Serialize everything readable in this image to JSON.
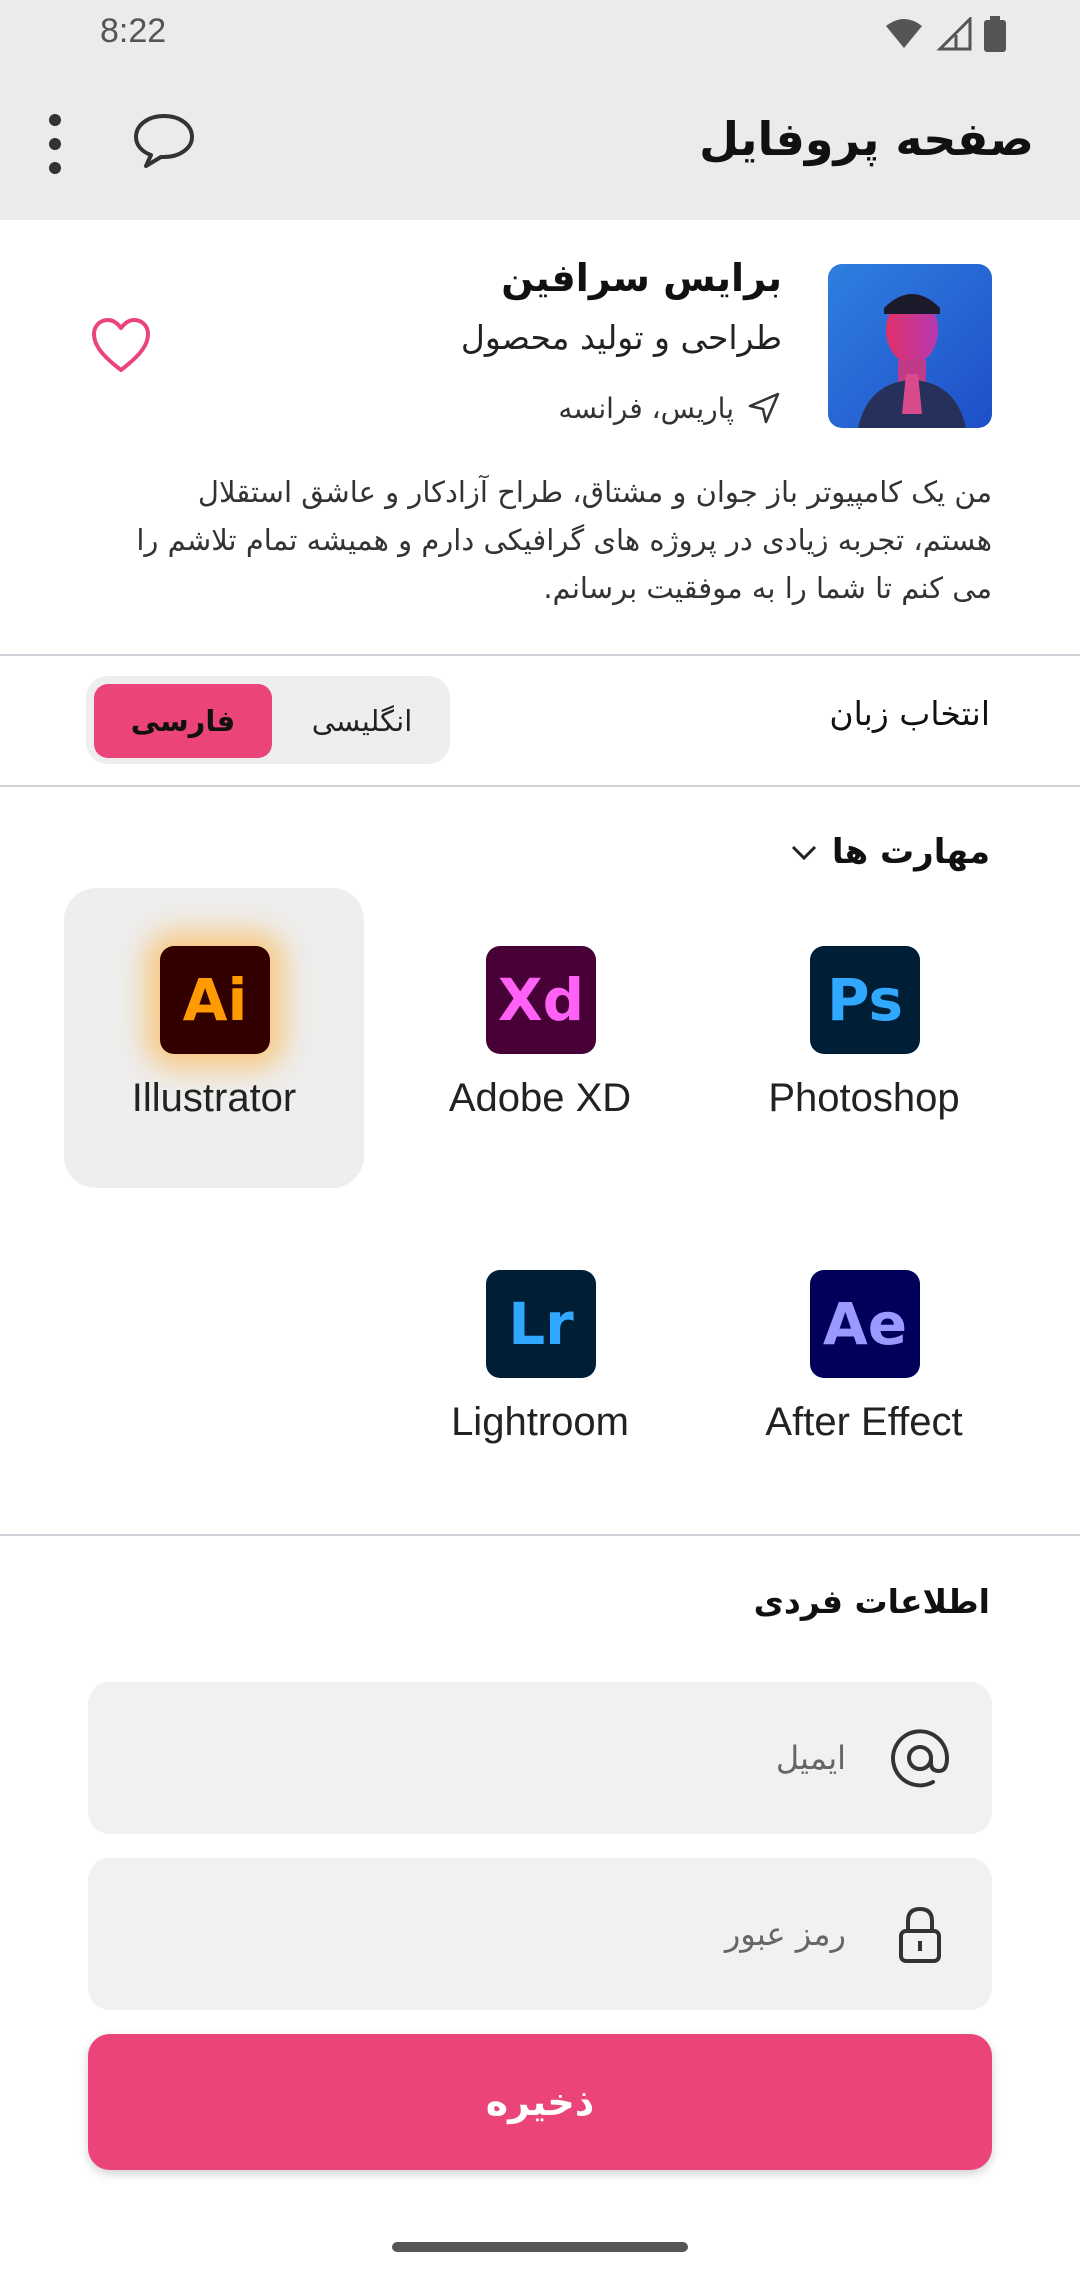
{
  "status_bar": {
    "time": "8:22",
    "icons": [
      "wifi-icon",
      "signal-icon",
      "battery-icon"
    ]
  },
  "app_bar": {
    "title": "صفحه پروفایل",
    "icons": [
      "chat-icon",
      "more-vert-icon"
    ]
  },
  "profile": {
    "name": "برایس سرافین",
    "role": "طراحی و تولید محصول",
    "location": "پاریس، فرانسه",
    "bio": "من یک کامپیوتر باز جوان و مشتاق، طراح آزادکار و عاشق استقلال هستم، تجربه زیادی در پروژه های گرافیکی دارم و همیشه تمام تلاشم را می کنم تا شما را به موفقیت برسانم."
  },
  "language": {
    "label": "انتخاب زبان",
    "options": [
      "فارسی",
      "انگلیسی"
    ],
    "selected": "فارسی"
  },
  "skills": {
    "title": "مهارت ها",
    "items": [
      {
        "label": "Photoshop",
        "abbr": "Ps",
        "bg": "#001e36",
        "fg": "#31a8ff",
        "selected": false
      },
      {
        "label": "Adobe XD",
        "abbr": "Xd",
        "bg": "#470137",
        "fg": "#ff61f6",
        "selected": false
      },
      {
        "label": "Illustrator",
        "abbr": "Ai",
        "bg": "#330000",
        "fg": "#ff9a00",
        "selected": true
      },
      {
        "label": "After Effect",
        "abbr": "Ae",
        "bg": "#00005b",
        "fg": "#9999ff",
        "selected": false
      },
      {
        "label": "Lightroom",
        "abbr": "Lr",
        "bg": "#001e36",
        "fg": "#31a8ff",
        "selected": false
      }
    ]
  },
  "personal_info": {
    "title": "اطلاعات فردی",
    "email_placeholder": "ایمیل",
    "email_value": "",
    "password_placeholder": "رمز عبور",
    "password_value": "",
    "save_label": "ذخیره"
  },
  "colors": {
    "accent": "#ea4479",
    "appbar_bg": "#ebebeb"
  }
}
